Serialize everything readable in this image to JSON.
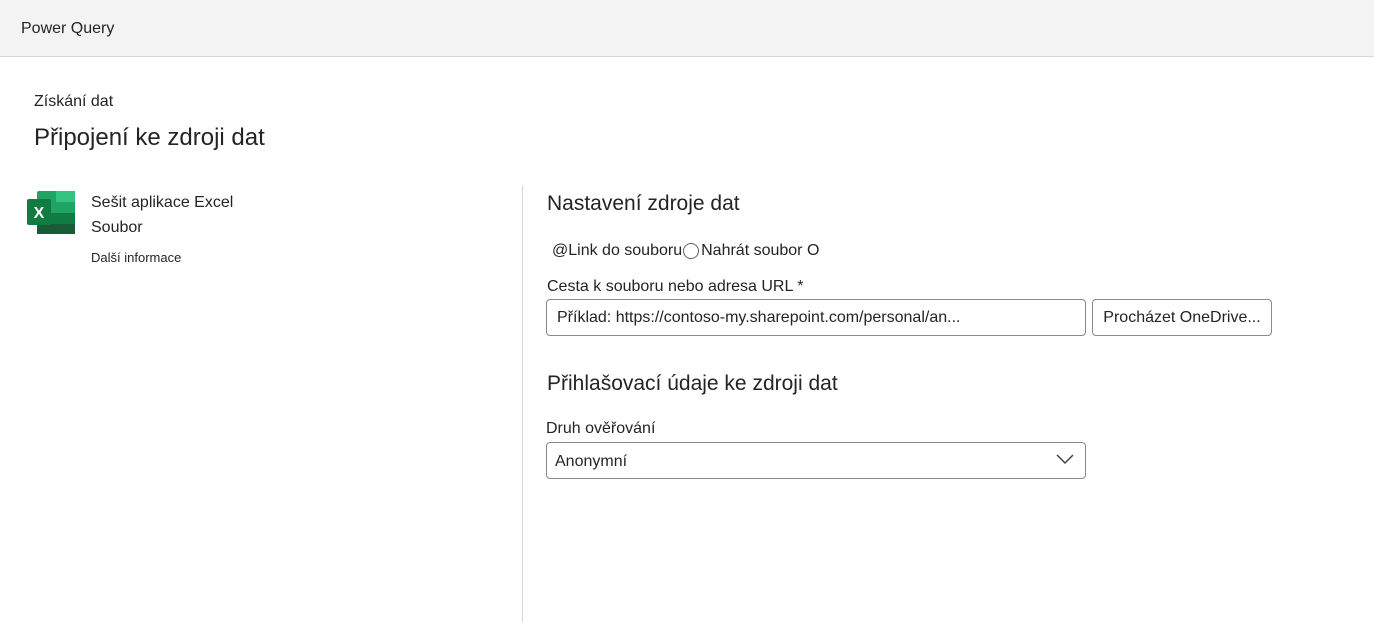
{
  "app": {
    "title": "Power Query"
  },
  "header": {
    "breadcrumb": "Získání dat",
    "title": "Připojení ke zdroji dat"
  },
  "connector": {
    "icon": "excel-icon",
    "name": "Sešit aplikace Excel",
    "category": "Soubor",
    "learn_more": "Další informace",
    "brand_color": "#107C41"
  },
  "settings": {
    "title": "Nastavení zdroje dat",
    "radio_option_1": "@Link do souboru",
    "radio_option_2": "Nahrát soubor O",
    "path_label": "Cesta k souboru nebo adresa URL *",
    "path_placeholder": "Příklad: https://contoso-my.sharepoint.com/personal/an...",
    "path_value": "",
    "browse_label": "Procházet OneDrive..."
  },
  "credentials": {
    "title": "Přihlašovací údaje ke zdroji dat",
    "auth_label": "Druh ověřování",
    "auth_value": "Anonymní"
  }
}
